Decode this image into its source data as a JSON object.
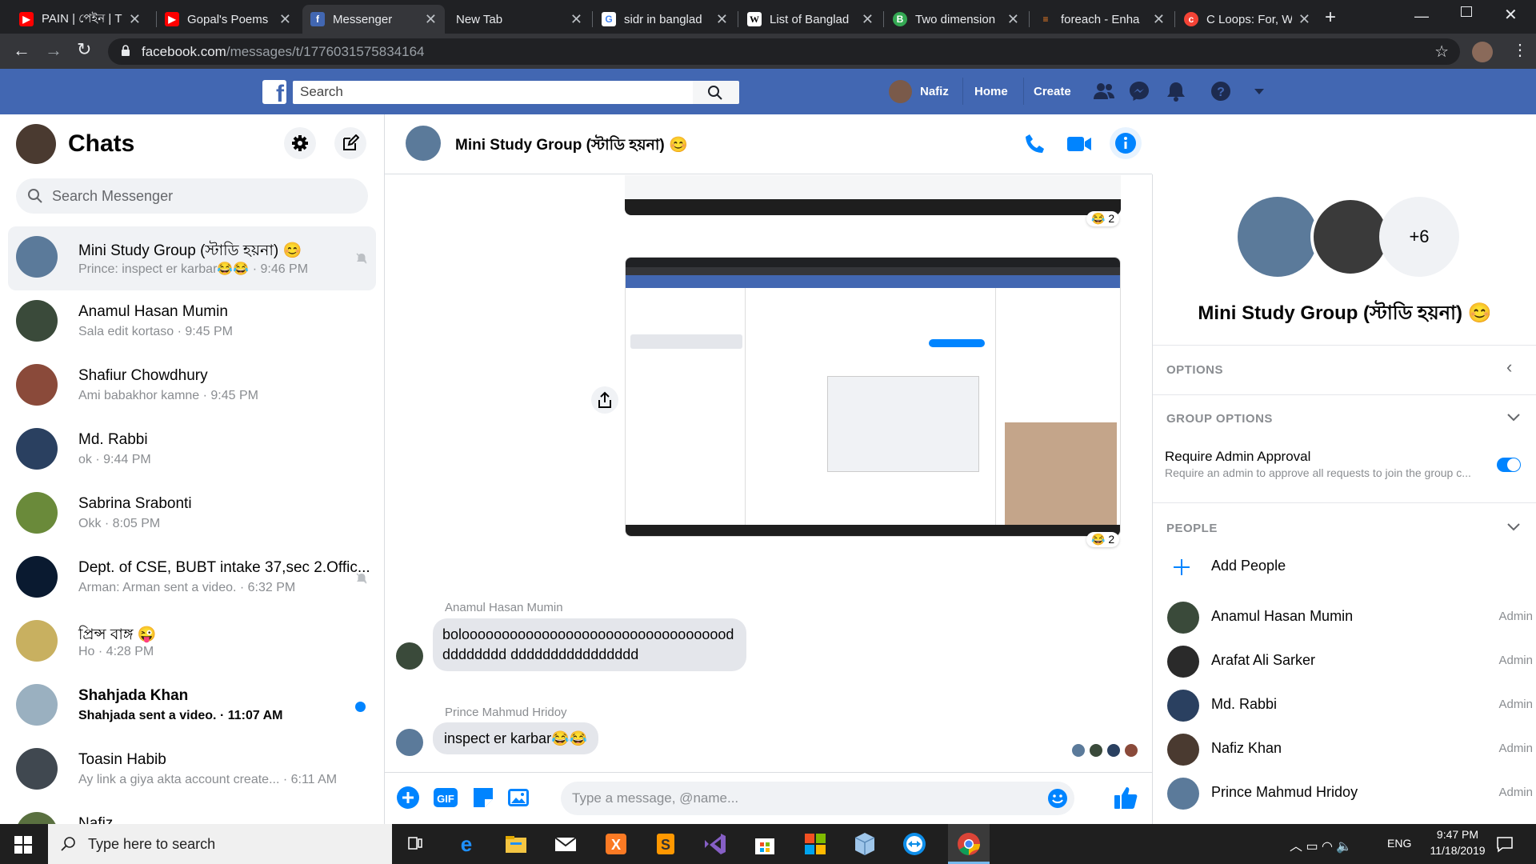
{
  "browser": {
    "tabs": [
      {
        "title": "PAIN | পেইন | T",
        "icon": "youtube-icon",
        "color": "#ff0000"
      },
      {
        "title": "Gopal's Poems",
        "icon": "youtube-icon",
        "color": "#ff0000"
      },
      {
        "title": "Messenger",
        "icon": "facebook-icon",
        "color": "#4267b2"
      },
      {
        "title": "New Tab",
        "icon": "",
        "color": ""
      },
      {
        "title": "sidr in banglad",
        "icon": "google-icon",
        "color": "#ffffff"
      },
      {
        "title": "List of Banglad",
        "icon": "wikipedia-icon",
        "color": "#ffffff"
      },
      {
        "title": "Two dimension",
        "icon": "b-icon",
        "color": "#34a853"
      },
      {
        "title": "foreach - Enha",
        "icon": "stackoverflow-icon",
        "color": "#f48024"
      },
      {
        "title": "C Loops: For, W",
        "icon": "programiz-icon",
        "color": "#f44336"
      }
    ],
    "url_domain": "facebook.com",
    "url_path": "/messages/t/1776031575834164"
  },
  "fb": {
    "search_placeholder": "Search",
    "user": "Nafiz",
    "nav_home": "Home",
    "nav_create": "Create"
  },
  "sidebar": {
    "title": "Chats",
    "search_placeholder": "Search Messenger",
    "chats": [
      {
        "name": "Mini Study Group (স্টাডি হয়না) 😊",
        "snippet": "Prince: inspect er karbar😂😂 · 9:46 PM",
        "muted": true,
        "active": true,
        "unread": false,
        "avatar": "#5b7a9a"
      },
      {
        "name": "Anamul Hasan Mumin",
        "snippet": "Sala edit kortaso · 9:45 PM",
        "muted": false,
        "active": false,
        "unread": false,
        "avatar": "#3a4a3a"
      },
      {
        "name": "Shafiur Chowdhury",
        "snippet": "Ami babakhor kamne · 9:45 PM",
        "muted": false,
        "active": false,
        "unread": false,
        "avatar": "#8a4a3a"
      },
      {
        "name": "Md. Rabbi",
        "snippet": "ok · 9:44 PM",
        "muted": false,
        "active": false,
        "unread": false,
        "avatar": "#2a4060"
      },
      {
        "name": "Sabrina Srabonti",
        "snippet": "Okk · 8:05 PM",
        "muted": false,
        "active": false,
        "unread": false,
        "avatar": "#6a8a3a"
      },
      {
        "name": "Dept. of CSE, BUBT intake 37,sec 2.Offic...",
        "snippet": "Arman: Arman sent a video. · 6:32 PM",
        "muted": true,
        "active": false,
        "unread": false,
        "avatar": "#0a1a30"
      },
      {
        "name": "প্রিন্স বাঙ্গ 😜",
        "snippet": "Ho · 4:28 PM",
        "muted": false,
        "active": false,
        "unread": false,
        "avatar": "#c8b060"
      },
      {
        "name": "Shahjada Khan",
        "snippet": "Shahjada sent a video. · 11:07 AM",
        "muted": false,
        "active": false,
        "unread": true,
        "avatar": "#9ab0c0"
      },
      {
        "name": "Toasin Habib",
        "snippet": "Ay link a giya akta account create... · 6:11 AM",
        "muted": false,
        "active": false,
        "unread": false,
        "avatar": "#404850"
      },
      {
        "name": "Nafiz",
        "snippet": "",
        "muted": false,
        "active": false,
        "unread": false,
        "avatar": "#5a7040"
      }
    ]
  },
  "conversation": {
    "title": "Mini Study Group (স্টাডি হয়না) 😊",
    "reaction_count_1": "😂 2",
    "reaction_count_2": "😂 2",
    "messages": [
      {
        "sender": "Anamul Hasan Mumin",
        "text": "boloooooooooooooooooooooooooooooooooddddddddd dddddddddddddddd"
      },
      {
        "sender": "Prince Mahmud Hridoy",
        "text": "inspect er karbar😂😂"
      }
    ],
    "composer_placeholder": "Type a message, @name..."
  },
  "info": {
    "group_name": "Mini Study Group (স্টাডি হয়না) 😊",
    "more_count": "+6",
    "options_label": "OPTIONS",
    "group_options_label": "GROUP OPTIONS",
    "require_title": "Require Admin Approval",
    "require_desc": "Require an admin to approve all requests to join the group c...",
    "people_label": "PEOPLE",
    "add_people": "Add People",
    "people": [
      {
        "name": "Anamul Hasan Mumin",
        "role": "Admin",
        "avatar": "#3a4a3a"
      },
      {
        "name": "Arafat Ali Sarker",
        "role": "Admin",
        "avatar": "#2a2a2a"
      },
      {
        "name": "Md. Rabbi",
        "role": "Admin",
        "avatar": "#2a4060"
      },
      {
        "name": "Nafiz Khan",
        "role": "Admin",
        "avatar": "#4a3a30"
      },
      {
        "name": "Prince Mahmud Hridoy",
        "role": "Admin",
        "avatar": "#5b7a9a"
      }
    ]
  },
  "taskbar": {
    "search_placeholder": "Type here to search",
    "lang": "ENG",
    "time": "9:47 PM",
    "date": "11/18/2019"
  },
  "colors": {
    "fb_blue": "#4267b2",
    "messenger_blue": "#0084ff",
    "chrome_dark": "#202124"
  }
}
